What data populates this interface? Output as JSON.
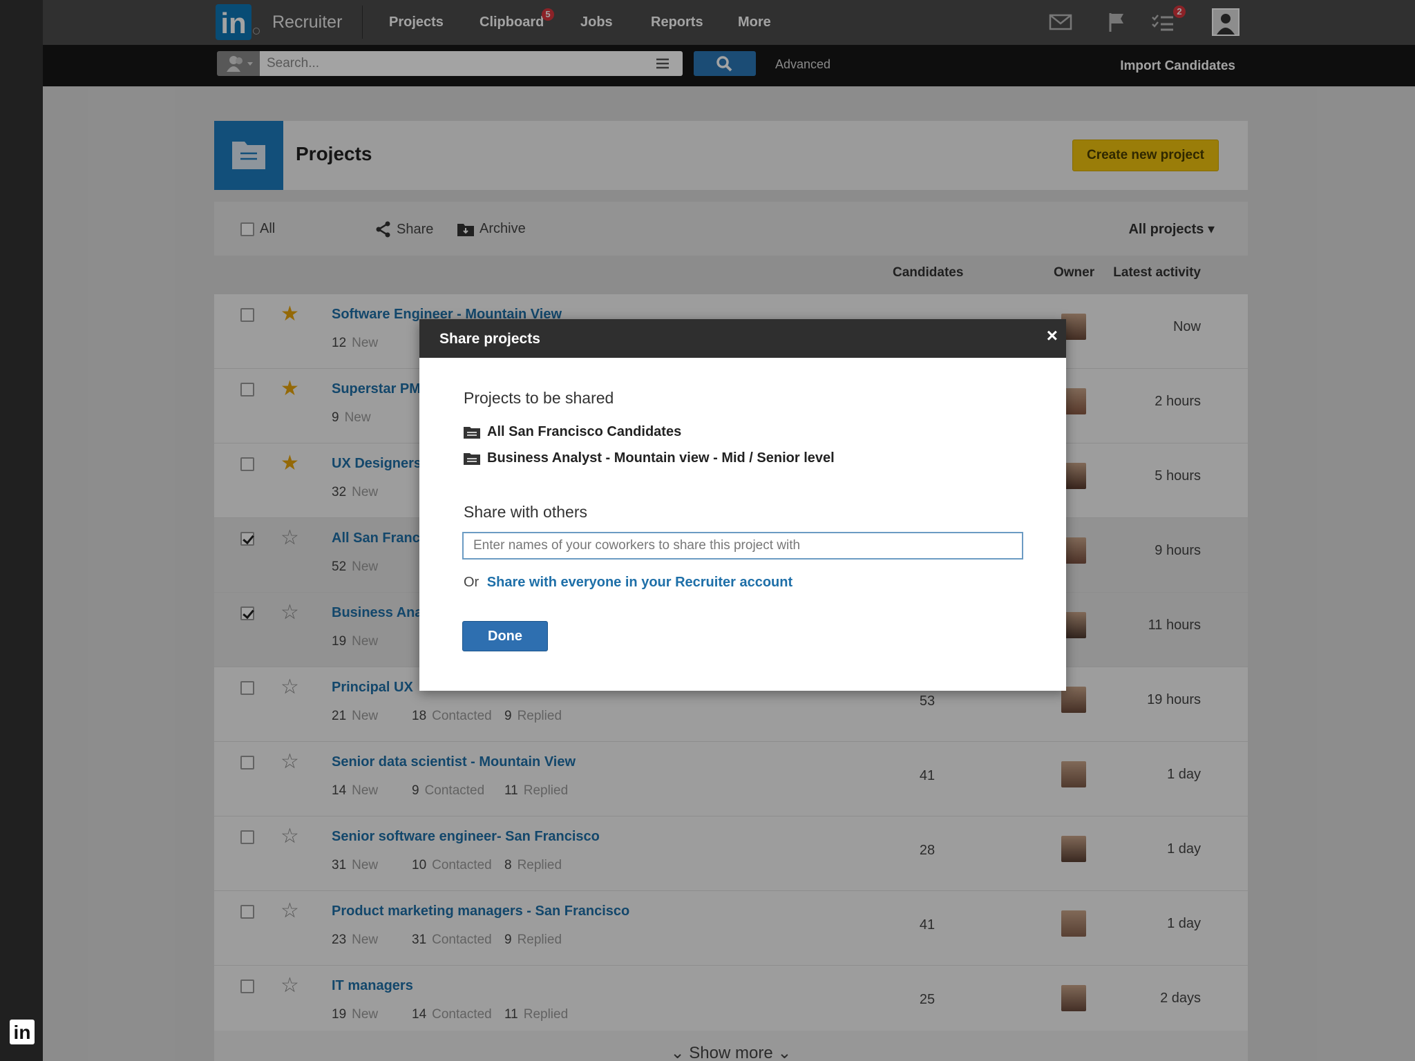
{
  "nav": {
    "logo_text": "in",
    "brand": "Recruiter",
    "links": [
      "Projects",
      "Clipboard",
      "Jobs",
      "Reports",
      "More"
    ],
    "clipboard_badge": "5",
    "tasks_badge": "2"
  },
  "search": {
    "placeholder": "Search...",
    "advanced_label": "Advanced",
    "import_label": "Import Candidates"
  },
  "page": {
    "title": "Projects",
    "create_button": "Create new project"
  },
  "toolbar": {
    "all_label": "All",
    "share_label": "Share",
    "archive_label": "Archive",
    "filter_label": "All projects ▾"
  },
  "columns": {
    "candidates": "Candidates",
    "owner": "Owner",
    "latest_activity": "Latest activity"
  },
  "projects": [
    {
      "name": "Software Engineer - Mountain View",
      "starred": true,
      "checked": false,
      "new": "12",
      "contacted": "",
      "replied": "",
      "candidates": "",
      "activity": "Now"
    },
    {
      "name": "Superstar PM",
      "starred": true,
      "checked": false,
      "new": "9",
      "contacted": "",
      "replied": "",
      "candidates": "",
      "activity": "2 hours"
    },
    {
      "name": "UX Designers",
      "starred": true,
      "checked": false,
      "new": "32",
      "contacted": "",
      "replied": "",
      "candidates": "",
      "activity": "5 hours"
    },
    {
      "name": "All San Franc",
      "starred": false,
      "checked": true,
      "new": "52",
      "contacted": "",
      "replied": "",
      "candidates": "",
      "activity": "9 hours"
    },
    {
      "name": "Business Ana",
      "starred": false,
      "checked": true,
      "new": "19",
      "contacted": "",
      "replied": "",
      "candidates": "",
      "activity": "11 hours"
    },
    {
      "name": "Principal UX",
      "starred": false,
      "checked": false,
      "new": "21",
      "contacted": "18",
      "replied": "9",
      "candidates": "53",
      "activity": "19 hours"
    },
    {
      "name": "Senior data scientist - Mountain View",
      "starred": false,
      "checked": false,
      "new": "14",
      "contacted": "9",
      "replied": "11",
      "candidates": "41",
      "activity": "1 day"
    },
    {
      "name": "Senior software engineer- San Francisco",
      "starred": false,
      "checked": false,
      "new": "31",
      "contacted": "10",
      "replied": "8",
      "candidates": "28",
      "activity": "1 day"
    },
    {
      "name": "Product marketing managers - San Francisco",
      "starred": false,
      "checked": false,
      "new": "23",
      "contacted": "31",
      "replied": "9",
      "candidates": "41",
      "activity": "1 day"
    },
    {
      "name": "IT managers",
      "starred": false,
      "checked": false,
      "new": "19",
      "contacted": "14",
      "replied": "11",
      "candidates": "25",
      "activity": "2 days"
    }
  ],
  "labels": {
    "new": "New",
    "contacted": "Contacted",
    "replied": "Replied"
  },
  "show_more": "Show more",
  "modal": {
    "title": "Share projects",
    "close": "×",
    "projects_heading": "Projects to be shared",
    "shared_projects": [
      "All San Francisco Candidates",
      "Business Analyst - Mountain view - Mid / Senior level"
    ],
    "share_heading": "Share with others",
    "input_placeholder": "Enter names of your coworkers to share this project with",
    "or_label": "Or",
    "share_all_link": "Share with everyone in your Recruiter account",
    "done_button": "Done"
  },
  "corner_logo": "in",
  "colors": {
    "link": "#1e6fa8",
    "accent_blue": "#1d7cbf",
    "create_yellow": "#f1c40f",
    "star": "#e8a50c",
    "badge": "#d9363e"
  }
}
